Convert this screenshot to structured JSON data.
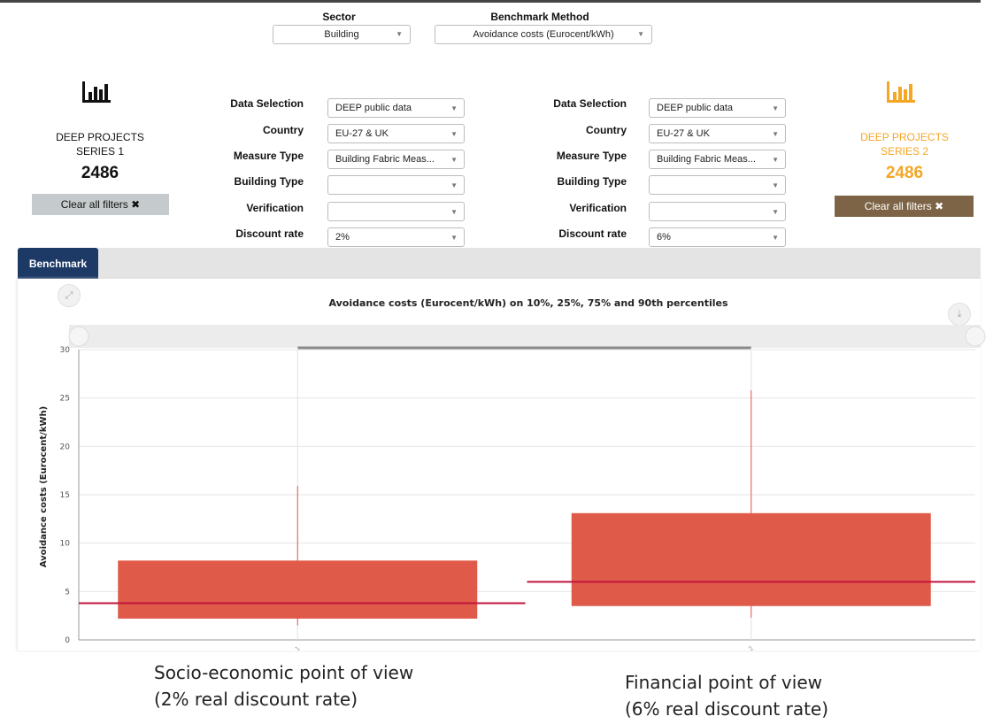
{
  "header": {
    "sector": {
      "label": "Sector",
      "value": "Building"
    },
    "benchmark_method": {
      "label": "Benchmark Method",
      "value": "Avoidance costs (Eurocent/kWh)"
    }
  },
  "series1": {
    "title_line1": "DEEP PROJECTS",
    "title_line2": "SERIES 1",
    "count": "2486",
    "clear_label": "Clear all filters ✖",
    "color": "#111111"
  },
  "series2": {
    "title_line1": "DEEP PROJECTS",
    "title_line2": "SERIES 2",
    "count": "2486",
    "clear_label": "Clear all filters ✖",
    "color": "#f5a623"
  },
  "filters_labels": {
    "data_selection": "Data Selection",
    "country": "Country",
    "measure_type": "Measure Type",
    "building_type": "Building Type",
    "verification": "Verification",
    "discount_rate": "Discount rate"
  },
  "filters1": {
    "data_selection": "DEEP public data",
    "country": "EU-27 & UK",
    "measure_type": "Building Fabric Meas...",
    "building_type": "",
    "verification": "",
    "discount_rate": "2%"
  },
  "filters2": {
    "data_selection": "DEEP public data",
    "country": "EU-27 & UK",
    "measure_type": "Building Fabric Meas...",
    "building_type": "",
    "verification": "",
    "discount_rate": "6%"
  },
  "tabs": {
    "active": "Benchmark"
  },
  "chart_data": {
    "type": "box",
    "title": "Avoidance costs (Eurocent/kWh) on 10%, 25%, 75% and 90th percentiles",
    "xlabel": "",
    "ylabel": "Avoidance costs (Eurocent/kWh)",
    "ylim": [
      0,
      30
    ],
    "yticks": [
      0,
      5,
      10,
      15,
      20,
      25,
      30
    ],
    "categories": [
      "1",
      "2"
    ],
    "boxes": [
      {
        "category": "1",
        "p10": 1.5,
        "p25": 2.2,
        "median": 3.8,
        "p75": 8.2,
        "p90": 15.9
      },
      {
        "category": "2",
        "p10": 2.3,
        "p25": 3.5,
        "median": 6.0,
        "p75": 13.1,
        "p90": 25.8
      }
    ],
    "colors": {
      "box": "#e05a4a",
      "median": "#c0143c",
      "whisker": "#e05a4a"
    },
    "grid": true
  },
  "captions": {
    "left_line1": "Socio-economic point of view",
    "left_line2": "(2% real discount rate)",
    "right_line1": "Financial point of view",
    "right_line2": "(6% real discount rate)"
  }
}
